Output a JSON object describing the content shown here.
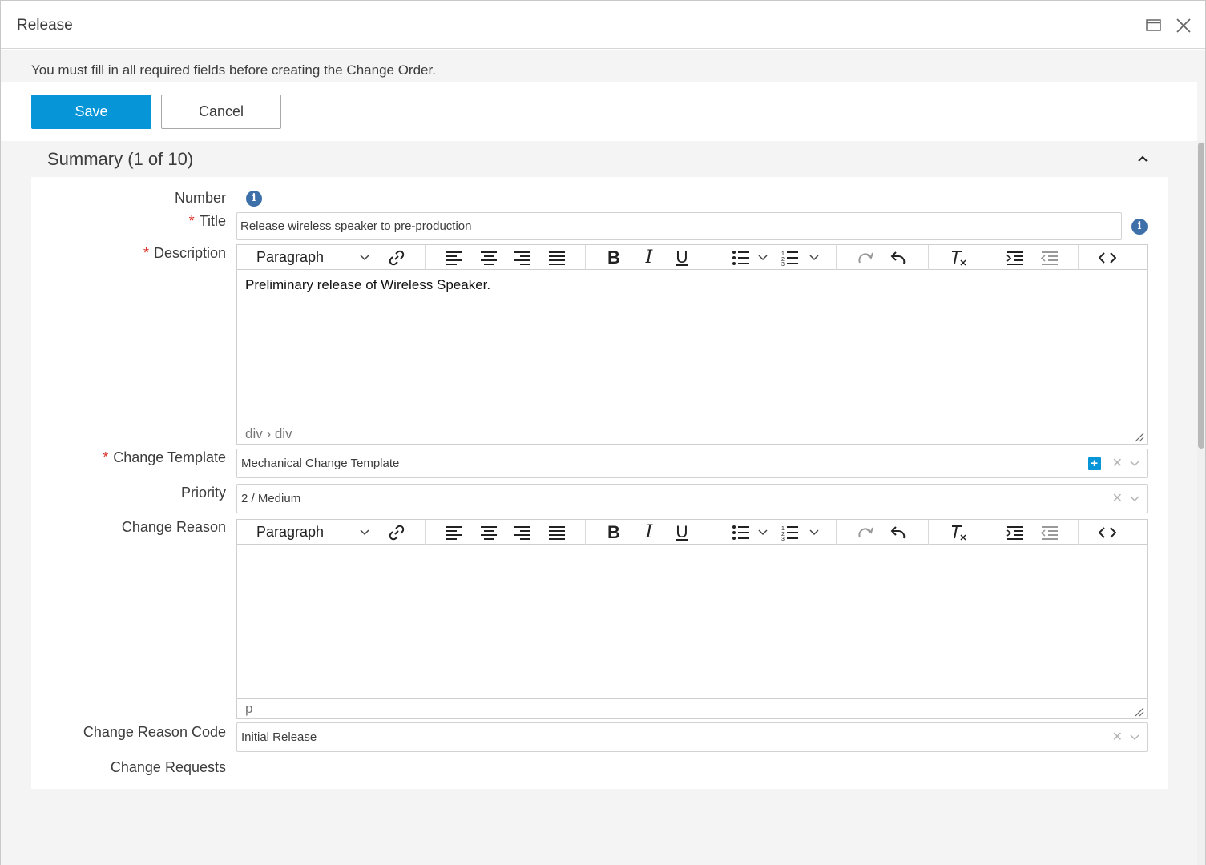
{
  "window": {
    "title": "Release"
  },
  "notice": "You must fill in all required fields before creating the Change Order.",
  "actions": {
    "save": "Save",
    "cancel": "Cancel"
  },
  "section": {
    "title": "Summary (1 of 10)"
  },
  "fields": {
    "number": {
      "label": "Number"
    },
    "title": {
      "label": "Title",
      "value": "Release wireless speaker to pre-production"
    },
    "description": {
      "label": "Description",
      "content": "Preliminary release of Wireless Speaker.",
      "path": "div › div"
    },
    "change_template": {
      "label": "Change Template",
      "value": "Mechanical Change Template"
    },
    "priority": {
      "label": "Priority",
      "value": "2 / Medium"
    },
    "change_reason": {
      "label": "Change Reason",
      "content": "",
      "path": "p"
    },
    "change_reason_code": {
      "label": "Change Reason Code",
      "value": "Initial Release"
    },
    "change_requests": {
      "label": "Change Requests"
    }
  },
  "required_marker": "*",
  "toolbar": {
    "paragraph": "Paragraph"
  },
  "colors": {
    "accent": "#0696d7",
    "required": "#d9342b",
    "info": "#3d6fa9"
  }
}
